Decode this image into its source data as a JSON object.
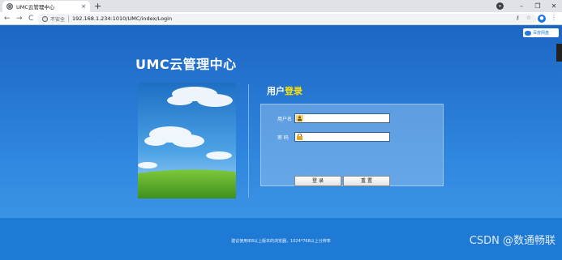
{
  "browser": {
    "tab_title": "UMC云管理中心",
    "tab_close": "×",
    "new_tab": "+",
    "insecure_label": "不安全",
    "url": "192.168.1.234:1010/UMC/index/Login",
    "back": "←",
    "forward": "→",
    "reload": "C",
    "key_icon": "⚷",
    "star_icon": "☆",
    "menu_icon": "⋮",
    "minimize": "–",
    "maximize": "❐",
    "close": "✕"
  },
  "page": {
    "brand_title": "UMC云管理中心",
    "login_heading_plain": "用户",
    "login_heading_accent": "登录",
    "username_label": "用户名",
    "password_label": "密 码",
    "login_button": "登 录",
    "reset_button": "重 置",
    "footer_text": "建议使用IE8以上版本的浏览器，1024*768以上分辨率",
    "extension_badge": "百度网盘",
    "watermark": "CSDN @数通畅联"
  },
  "colors": {
    "page_blue": "#2f86de",
    "accent_yellow": "#ffe100"
  }
}
